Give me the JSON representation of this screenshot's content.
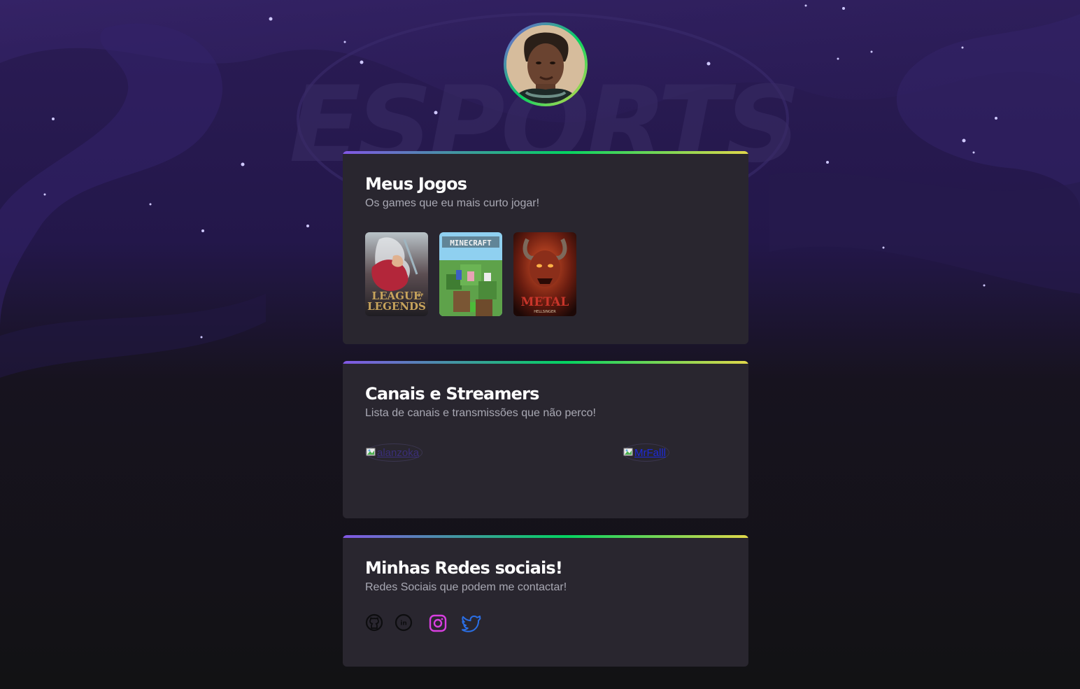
{
  "profile": {
    "avatar_alt": "Foto de perfil"
  },
  "games_card": {
    "title": "Meus Jogos",
    "subtitle": "Os games que eu mais curto jogar!",
    "games": [
      {
        "name": "League of Legends",
        "line1": "LEAGUE",
        "line1b": "OF",
        "line2": "LEGENDS"
      },
      {
        "name": "Minecraft",
        "logo": "MINECRAFT"
      },
      {
        "name": "Metal: Hellsinger",
        "logo": "METAL",
        "sub": "HELLSINGER"
      }
    ]
  },
  "channels_card": {
    "title": "Canais e Streamers",
    "subtitle": "Lista de canais e transmissões que não perco!",
    "channels": [
      {
        "label": "alanzoka"
      },
      {
        "label": "MrFalll"
      }
    ]
  },
  "social_card": {
    "title": "Minhas Redes sociais!",
    "subtitle": "Redes Sociais que podem me contactar!",
    "icons": [
      "github-icon",
      "linkedin-icon",
      "instagram-icon",
      "twitter-icon"
    ]
  },
  "colors": {
    "background": "#121214",
    "card": "#29262f",
    "gradient": [
      "#8257e5",
      "#04d361",
      "#e1d84a"
    ],
    "instagram": "#d83fe0",
    "twitter": "#2a6fe6"
  }
}
